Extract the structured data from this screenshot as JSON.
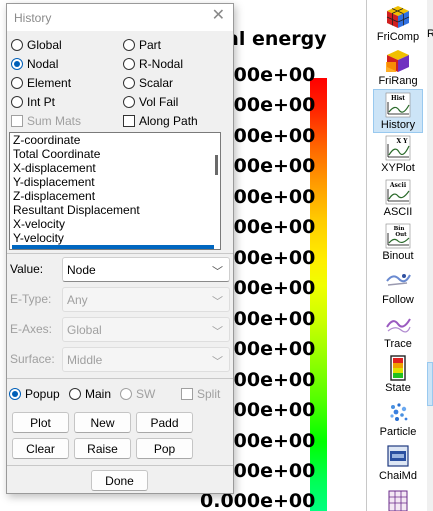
{
  "plot": {
    "title": "al energy",
    "scale_labels": [
      "0.000e+00",
      "0.000e+00",
      "0.000e+00",
      "0.000e+00",
      "0.000e+00",
      "0.000e+00",
      "0.000e+00",
      "0.000e+00",
      "0.000e+00",
      "0.000e+00",
      "0.000e+00",
      "0.000e+00",
      "0.000e+00",
      "0.000e+00",
      "0.000e+00"
    ]
  },
  "dialog": {
    "title": "History",
    "close_glyph": "✕",
    "types": {
      "global": "Global",
      "part": "Part",
      "nodal": "Nodal",
      "r_nodal": "R-Nodal",
      "element": "Element",
      "scalar": "Scalar",
      "int_pt": "Int Pt",
      "vol_fail": "Vol Fail",
      "sum_mats": "Sum Mats",
      "along_path": "Along Path"
    },
    "selected_type": "Nodal",
    "components": [
      "Z-coordinate",
      "Total Coordinate",
      "X-displacement",
      "Y-displacement",
      "Z-displacement",
      "Resultant Displacement",
      "X-velocity",
      "Y-velocity"
    ],
    "fields": {
      "value_label": "Value:",
      "value": "Node",
      "etype_label": "E-Type:",
      "etype": "Any",
      "eaxes_label": "E-Axes:",
      "eaxes": "Global",
      "surface_label": "Surface:",
      "surface": "Middle"
    },
    "output": {
      "popup": "Popup",
      "main": "Main",
      "sw": "SW",
      "split": "Split"
    },
    "buttons": {
      "plot": "Plot",
      "new": "New",
      "padd": "Padd",
      "clear": "Clear",
      "raise": "Raise",
      "pop": "Pop",
      "done": "Done"
    }
  },
  "toolbar": [
    {
      "label": "FriComp",
      "icon": "cube-icon"
    },
    {
      "label": "FriRang",
      "icon": "cube-range-icon"
    },
    {
      "label": "History",
      "icon": "history-icon",
      "active": true
    },
    {
      "label": "XYPlot",
      "icon": "xyplot-icon"
    },
    {
      "label": "ASCII",
      "icon": "ascii-icon"
    },
    {
      "label": "Binout",
      "icon": "binout-icon"
    },
    {
      "label": "Follow",
      "icon": "follow-icon"
    },
    {
      "label": "Trace",
      "icon": "trace-icon"
    },
    {
      "label": "State",
      "icon": "state-icon"
    },
    {
      "label": "Particle",
      "icon": "particle-icon"
    },
    {
      "label": "ChaiMd",
      "icon": "chaimd-icon"
    }
  ],
  "right_strip_letter": "R",
  "colors": {
    "accent": "#0067c0",
    "active_tool": "#cce4f7"
  }
}
